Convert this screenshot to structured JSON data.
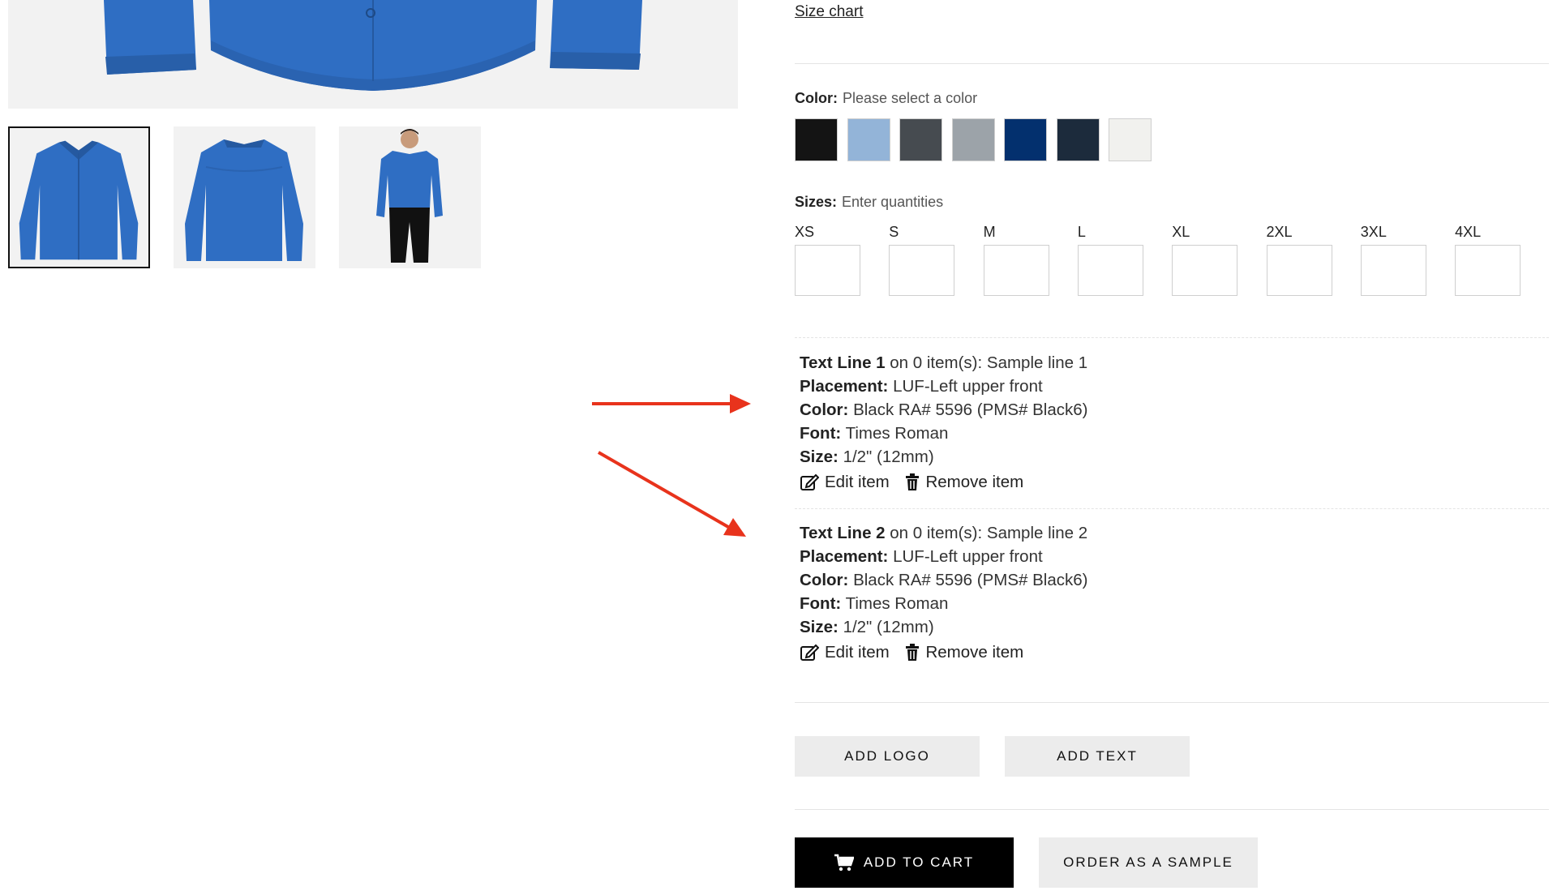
{
  "product": {
    "size_chart_label": "Size chart",
    "shirt_color": "#2f6ec3"
  },
  "color": {
    "label": "Color:",
    "hint": "Please select a color",
    "swatches": [
      "#141414",
      "#93b4d8",
      "#464b50",
      "#9ca3a9",
      "#03306e",
      "#1c2b3c",
      "#f1f1ee"
    ]
  },
  "sizes": {
    "label": "Sizes:",
    "hint": "Enter quantities",
    "items": [
      "XS",
      "S",
      "M",
      "L",
      "XL",
      "2XL",
      "3XL",
      "4XL"
    ]
  },
  "decorations": [
    {
      "title": "Text Line 1",
      "summary": "on 0 item(s): Sample line 1",
      "placement_label": "Placement:",
      "placement": "LUF-Left upper front",
      "color_label": "Color:",
      "color": "Black RA# 5596 (PMS# Black6)",
      "font_label": "Font:",
      "font": "Times Roman",
      "size_label": "Size:",
      "size": "1/2\" (12mm)",
      "edit_label": "Edit item",
      "remove_label": "Remove item"
    },
    {
      "title": "Text Line 2",
      "summary": "on 0 item(s): Sample line 2",
      "placement_label": "Placement:",
      "placement": "LUF-Left upper front",
      "color_label": "Color:",
      "color": "Black RA# 5596 (PMS# Black6)",
      "font_label": "Font:",
      "font": "Times Roman",
      "size_label": "Size:",
      "size": "1/2\" (12mm)",
      "edit_label": "Edit item",
      "remove_label": "Remove item"
    }
  ],
  "buttons": {
    "add_logo": "ADD LOGO",
    "add_text": "ADD TEXT",
    "add_to_cart": "ADD TO CART",
    "order_sample": "ORDER AS A SAMPLE"
  },
  "annotation_color": "#e8331c"
}
